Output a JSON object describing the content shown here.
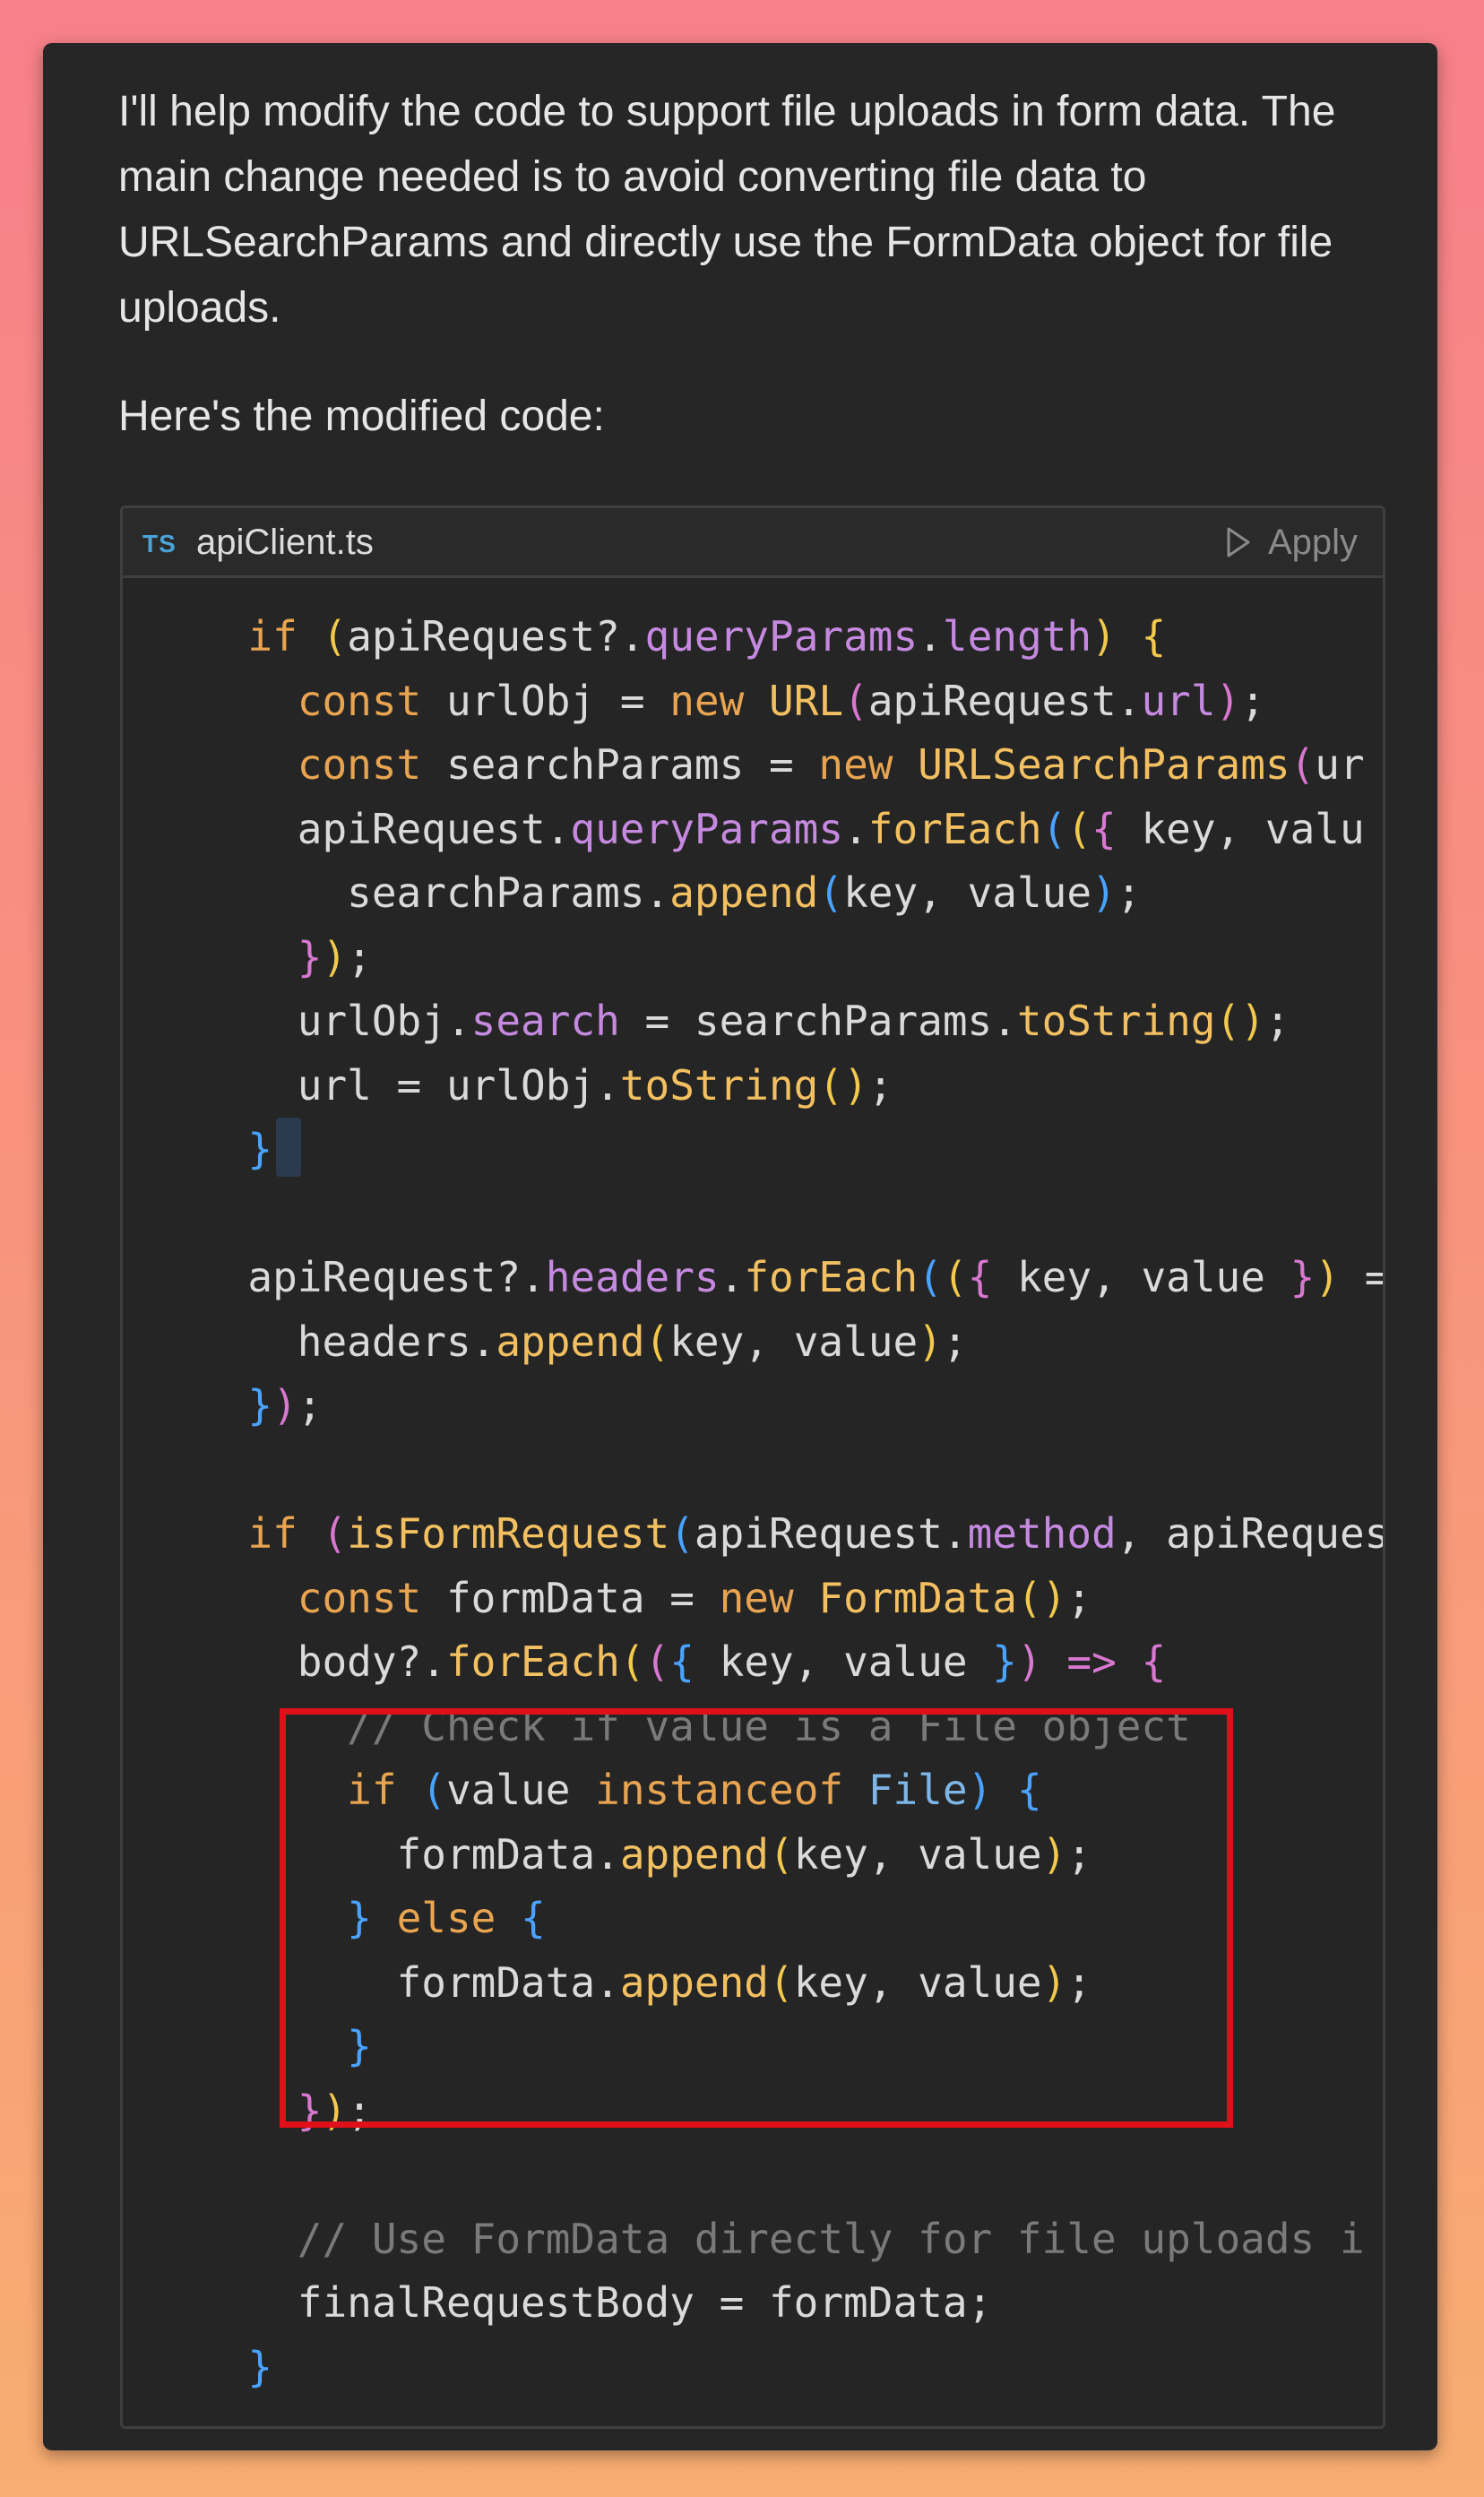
{
  "message": {
    "intro": "I'll help modify the code to support file uploads in form data. The main change needed is to avoid converting file data to URLSearchParams and directly use the FormData object for file uploads.",
    "lead": "Here's the modified code:"
  },
  "code_block": {
    "language_badge": "TS",
    "file_name": "apiClient.ts",
    "apply_label": "Apply",
    "apply_icon": "play-triangle-icon",
    "lines": [
      "  if (apiRequest?.queryParams.length) {",
      "    const urlObj = new URL(apiRequest.url);",
      "    const searchParams = new URLSearchParams(ur",
      "    apiRequest.queryParams.forEach(({ key, valu",
      "      searchParams.append(key, value);",
      "    });",
      "    urlObj.search = searchParams.toString();",
      "    url = urlObj.toString();",
      "  }",
      "",
      "  apiRequest?.headers.forEach(({ key, value }) =",
      "    headers.append(key, value);",
      "  });",
      "",
      "  if (isFormRequest(apiRequest.method, apiReques",
      "    const formData = new FormData();",
      "    body?.forEach(({ key, value }) => {",
      "      // Check if value is a File object",
      "      if (value instanceof File) {",
      "        formData.append(key, value);",
      "      } else {",
      "        formData.append(key, value);",
      "      }",
      "    });",
      "",
      "    // Use FormData directly for file uploads i",
      "    finalRequestBody = formData;",
      "  }"
    ]
  },
  "colors": {
    "highlight_border": "#e0101a",
    "keyword": "#f0c060",
    "property": "#c58ae0",
    "class_name": "#7fb6e8",
    "comment": "#7a7a7a"
  }
}
